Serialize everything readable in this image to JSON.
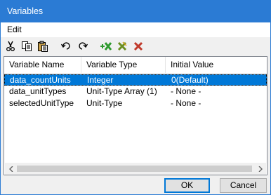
{
  "window": {
    "title": "Variables"
  },
  "menu": {
    "edit": "Edit"
  },
  "toolbar": {
    "cut": "scissors-icon",
    "copy": "copy-icon",
    "paste": "paste-icon",
    "undo": "undo-icon",
    "redo": "redo-icon"
  },
  "table": {
    "columns": [
      "Variable Name",
      "Variable Type",
      "Initial Value"
    ],
    "rows": [
      {
        "name": "data_countUnits",
        "type": "Integer",
        "value": "0(Default)"
      },
      {
        "name": "data_unitTypes",
        "type": "Unit-Type Array (1)",
        "value": "- None -"
      },
      {
        "name": "selectedUnitType",
        "type": "Unit-Type",
        "value": "- None -"
      }
    ]
  },
  "buttons": {
    "ok": "OK",
    "cancel": "Cancel"
  },
  "colors": {
    "titlebar": "#2b7bd4",
    "selection": "#0078d7",
    "add_green": "#2e9a2e",
    "delete_red": "#c0392b"
  }
}
